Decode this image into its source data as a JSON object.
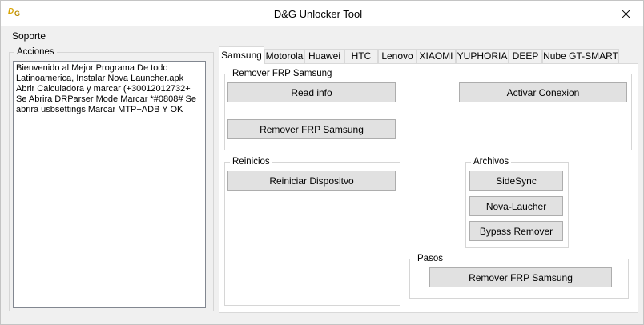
{
  "window": {
    "title": "D&G Unlocker Tool",
    "icon_text_main": "D",
    "icon_text_small": "G"
  },
  "menu": {
    "items": [
      "Soporte"
    ]
  },
  "acciones": {
    "label": "Acciones",
    "text": "Bienvenido al Mejor Programa De todo Latinoamerica, Instalar Nova Launcher.apk  Abrir Calculadora y marcar (+30012012732+  Se Abrira DRParser Mode Marcar *#0808# Se abrira usbsettings Marcar MTP+ADB Y OK"
  },
  "tabs": [
    "Samsung",
    "Motorola",
    "Huawei",
    "HTC",
    "Lenovo",
    "XIAOMI",
    "YUPHORIA",
    "DEEP",
    "Nube GT-SMART"
  ],
  "samsung": {
    "frp_group": {
      "label": "Remover FRP Samsung",
      "read_info": "Read info",
      "activar_conexion": "Activar Conexion",
      "remover_frp": "Remover FRP Samsung"
    },
    "reinicios": {
      "label": "Reinicios",
      "reiniciar": "Reiniciar Dispositvo"
    },
    "archivos": {
      "label": "Archivos",
      "sidesync": "SideSync",
      "nova": "Nova-Laucher",
      "bypass": "Bypass Remover"
    },
    "pasos": {
      "label": "Pasos",
      "remover_frp": "Remover FRP Samsung"
    }
  }
}
